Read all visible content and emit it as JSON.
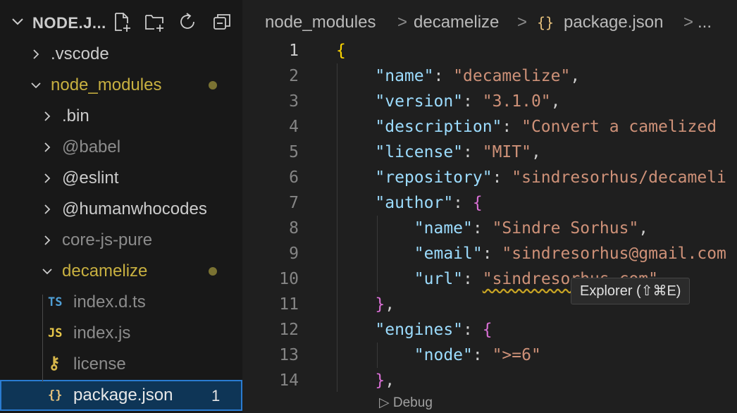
{
  "explorer": {
    "title": "NODE.J...",
    "actions": [
      "new-file-icon",
      "new-folder-icon",
      "refresh-icon",
      "collapse-all-icon"
    ],
    "tree": [
      {
        "label": ".vscode",
        "depth": 0,
        "expanded": false,
        "color": "#cccccc"
      },
      {
        "label": "node_modules",
        "depth": 0,
        "expanded": true,
        "color": "#c8b040",
        "modified": true
      },
      {
        "label": ".bin",
        "depth": 1,
        "expanded": false,
        "color": "#cccccc"
      },
      {
        "label": "@babel",
        "depth": 1,
        "expanded": false,
        "color": "#8c8c8c"
      },
      {
        "label": "@eslint",
        "depth": 1,
        "expanded": false,
        "color": "#cccccc"
      },
      {
        "label": "@humanwhocodes",
        "depth": 1,
        "expanded": false,
        "color": "#cccccc"
      },
      {
        "label": "core-js-pure",
        "depth": 1,
        "expanded": false,
        "color": "#8c8c8c"
      },
      {
        "label": "decamelize",
        "depth": 1,
        "expanded": true,
        "color": "#c8b040",
        "modified": true
      },
      {
        "label": "index.d.ts",
        "depth": 2,
        "file": "TS",
        "color": "#8c8c8c"
      },
      {
        "label": "index.js",
        "depth": 2,
        "file": "JS",
        "color": "#8c8c8c"
      },
      {
        "label": "license",
        "depth": 2,
        "file": "key",
        "color": "#8c8c8c"
      },
      {
        "label": "package.json",
        "depth": 2,
        "file": "{}",
        "color": "#e8e8e8",
        "selected": true,
        "badge": "1"
      }
    ]
  },
  "breadcrumb": {
    "items": [
      "node_modules",
      "decamelize",
      "package.json",
      "..."
    ],
    "separator": ">",
    "json_icon": "{}"
  },
  "editor": {
    "active_line": "1",
    "lines": [
      {
        "n": "1",
        "tokens": [
          [
            "b1",
            "{"
          ]
        ]
      },
      {
        "n": "2",
        "tokens": [
          [
            "p",
            "    "
          ],
          [
            "k",
            "\"name\""
          ],
          [
            "p",
            ": "
          ],
          [
            "s",
            "\"decamelize\""
          ],
          [
            "p",
            ","
          ]
        ]
      },
      {
        "n": "3",
        "tokens": [
          [
            "p",
            "    "
          ],
          [
            "k",
            "\"version\""
          ],
          [
            "p",
            ": "
          ],
          [
            "s",
            "\"3.1.0\""
          ],
          [
            "p",
            ","
          ]
        ]
      },
      {
        "n": "4",
        "tokens": [
          [
            "p",
            "    "
          ],
          [
            "k",
            "\"description\""
          ],
          [
            "p",
            ": "
          ],
          [
            "s",
            "\"Convert a camelized"
          ]
        ]
      },
      {
        "n": "5",
        "tokens": [
          [
            "p",
            "    "
          ],
          [
            "k",
            "\"license\""
          ],
          [
            "p",
            ": "
          ],
          [
            "s",
            "\"MIT\""
          ],
          [
            "p",
            ","
          ]
        ]
      },
      {
        "n": "6",
        "tokens": [
          [
            "p",
            "    "
          ],
          [
            "k",
            "\"repository\""
          ],
          [
            "p",
            ": "
          ],
          [
            "s",
            "\"sindresorhus/decameli"
          ]
        ]
      },
      {
        "n": "7",
        "tokens": [
          [
            "p",
            "    "
          ],
          [
            "k",
            "\"author\""
          ],
          [
            "p",
            ": "
          ],
          [
            "b2",
            "{"
          ]
        ]
      },
      {
        "n": "8",
        "tokens": [
          [
            "p",
            "        "
          ],
          [
            "k",
            "\"name\""
          ],
          [
            "p",
            ": "
          ],
          [
            "s",
            "\"Sindre Sorhus\""
          ],
          [
            "p",
            ","
          ]
        ]
      },
      {
        "n": "9",
        "tokens": [
          [
            "p",
            "        "
          ],
          [
            "k",
            "\"email\""
          ],
          [
            "p",
            ": "
          ],
          [
            "s",
            "\"sindresorhus@gmail.com"
          ]
        ]
      },
      {
        "n": "10",
        "tokens": [
          [
            "p",
            "        "
          ],
          [
            "k",
            "\"url\""
          ],
          [
            "p",
            ": "
          ],
          [
            "sq",
            "\"sindresorhus.com\""
          ]
        ]
      },
      {
        "n": "11",
        "tokens": [
          [
            "p",
            "    "
          ],
          [
            "b2",
            "}"
          ],
          [
            "p",
            ","
          ]
        ]
      },
      {
        "n": "12",
        "tokens": [
          [
            "p",
            "    "
          ],
          [
            "k",
            "\"engines\""
          ],
          [
            "p",
            ": "
          ],
          [
            "b2",
            "{"
          ]
        ]
      },
      {
        "n": "13",
        "tokens": [
          [
            "p",
            "        "
          ],
          [
            "k",
            "\"node\""
          ],
          [
            "p",
            ": "
          ],
          [
            "s",
            "\">=6\""
          ]
        ]
      },
      {
        "n": "14",
        "tokens": [
          [
            "p",
            "    "
          ],
          [
            "b2",
            "}"
          ],
          [
            "p",
            ","
          ]
        ]
      }
    ],
    "codelens": "Debug"
  },
  "tooltip": {
    "text": "Explorer (⇧⌘E)"
  }
}
